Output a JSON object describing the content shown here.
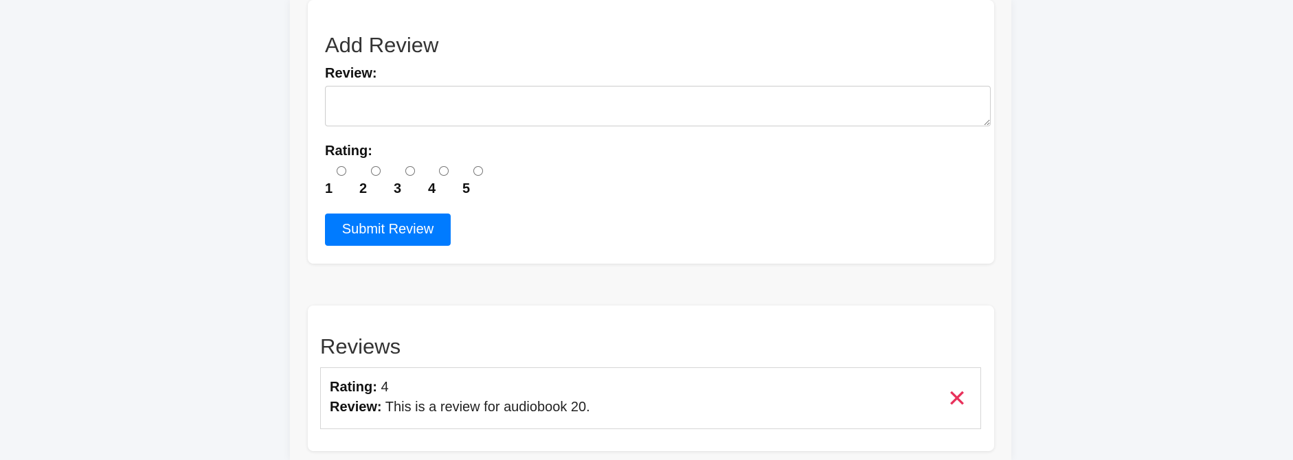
{
  "add_review": {
    "title": "Add Review",
    "review_label": "Review:",
    "review_value": "",
    "rating_label": "Rating:",
    "rating_options": [
      "1",
      "2",
      "3",
      "4",
      "5"
    ],
    "submit_label": "Submit Review"
  },
  "reviews": {
    "title": "Reviews",
    "items": [
      {
        "rating_label": "Rating:",
        "rating": "4",
        "review_label": "Review:",
        "review": "This is a review for audiobook 20.",
        "delete_icon": "close-icon",
        "delete_glyph": "✕"
      }
    ]
  },
  "colors": {
    "accent": "#007bff",
    "delete": "#e8315b"
  }
}
